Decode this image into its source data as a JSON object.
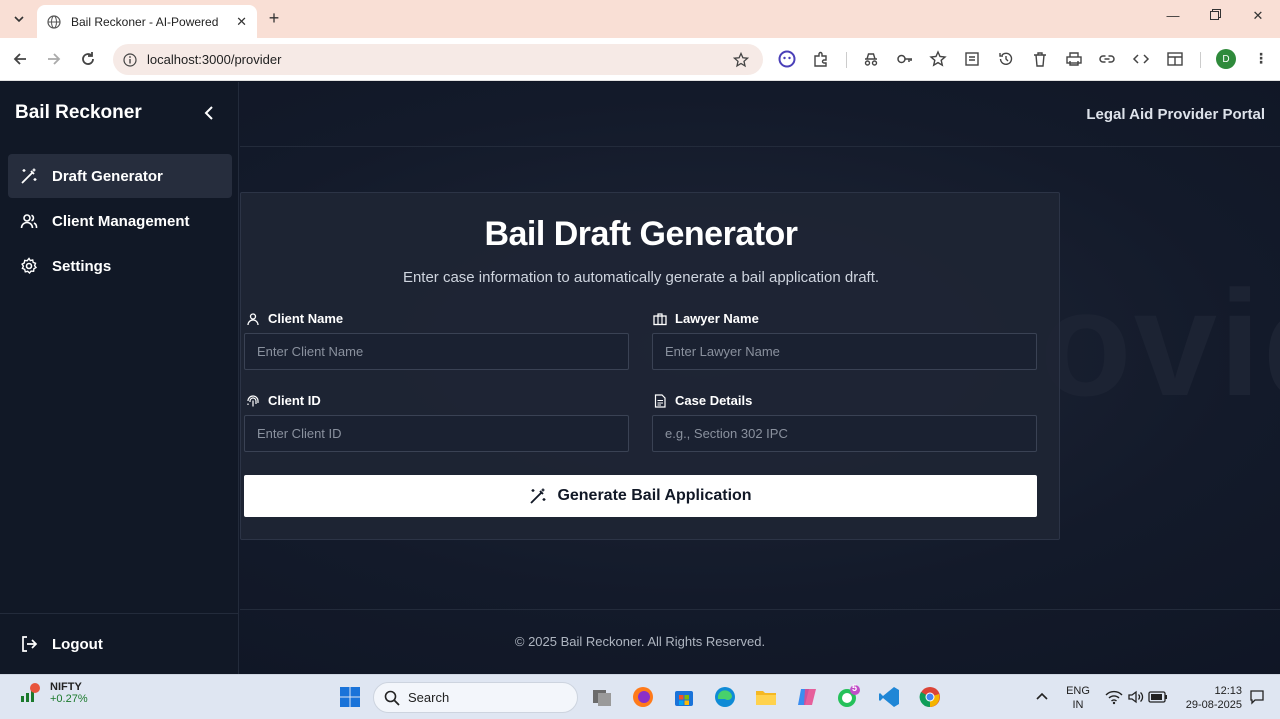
{
  "browser": {
    "tab_title": "Bail Reckoner - AI-Powered Bail",
    "url": "localhost:3000/provider",
    "profile_initial": "D"
  },
  "sidebar": {
    "brand": "Bail Reckoner",
    "items": [
      {
        "label": "Draft Generator",
        "icon": "magic-wand-icon",
        "active": true
      },
      {
        "label": "Client Management",
        "icon": "users-icon",
        "active": false
      },
      {
        "label": "Settings",
        "icon": "gear-icon",
        "active": false
      }
    ],
    "logout_label": "Logout"
  },
  "header": {
    "portal_title": "Legal Aid Provider Portal"
  },
  "watermark": "ovid",
  "form": {
    "title": "Bail Draft Generator",
    "subtitle": "Enter case information to automatically generate a bail application draft.",
    "client_name": {
      "label": "Client Name",
      "placeholder": "Enter Client Name",
      "value": ""
    },
    "lawyer_name": {
      "label": "Lawyer Name",
      "placeholder": "Enter Lawyer Name",
      "value": ""
    },
    "client_id": {
      "label": "Client ID",
      "placeholder": "Enter Client ID",
      "value": ""
    },
    "case_details": {
      "label": "Case Details",
      "placeholder": "e.g., Section 302 IPC",
      "value": ""
    },
    "submit_label": "Generate Bail Application"
  },
  "footer": {
    "text": "© 2025 Bail Reckoner. All Rights Reserved."
  },
  "taskbar": {
    "stock_name": "NIFTY",
    "stock_change": "+0.27%",
    "search_label": "Search",
    "whatsapp_badge": "5",
    "lang_line1": "ENG",
    "lang_line2": "IN",
    "time": "12:13",
    "date": "29-08-2025"
  },
  "colors": {
    "background": "#0f1524",
    "sidebar": "#111826",
    "card": "#1e2534",
    "button": "#ffffff"
  }
}
